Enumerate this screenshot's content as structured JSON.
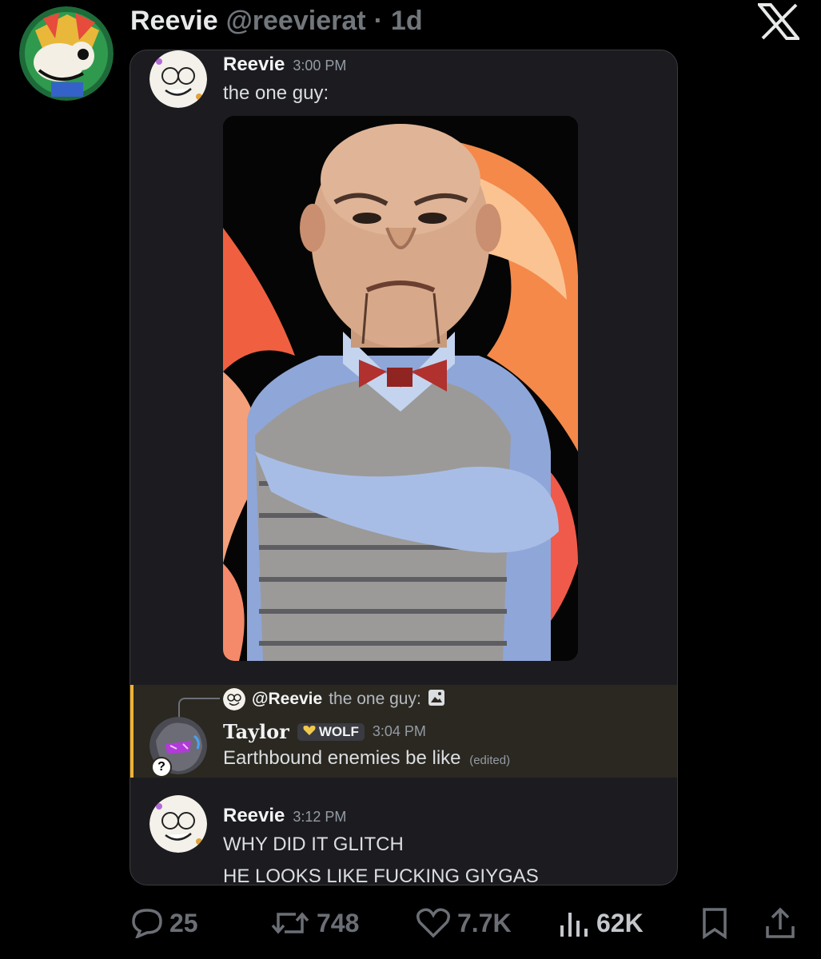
{
  "tweet": {
    "display_name": "Reevie",
    "handle": "@reevierat",
    "separator": "·",
    "age": "1d"
  },
  "discord": {
    "message1": {
      "author": "Reevie",
      "time": "3:00 PM",
      "text": "the one guy:"
    },
    "reply": {
      "mention": "@Reevie",
      "snippet": "the one guy:",
      "author": "Taylor",
      "tag": "WOLF",
      "time": "3:04 PM",
      "text": "Earthbound enemies be like",
      "edited": "(edited)",
      "badge": "?"
    },
    "message2": {
      "author": "Reevie",
      "time": "3:12 PM",
      "line1": "WHY DID IT GLITCH",
      "line2": "HE LOOKS LIKE FUCKING GIYGAS"
    }
  },
  "actions": {
    "replies": "25",
    "reposts": "748",
    "likes": "7.7K",
    "views": "62K"
  },
  "colors": {
    "background": "#000000",
    "card": "#1c1c20",
    "reply_highlight": "#2b2821",
    "reply_accent": "#f0b232",
    "muted": "#71767b"
  },
  "icons": [
    "x-logo-icon",
    "reply-icon",
    "repost-icon",
    "like-icon",
    "views-icon",
    "bookmark-icon",
    "share-icon",
    "image-attachment-icon",
    "heart-tag-icon"
  ]
}
